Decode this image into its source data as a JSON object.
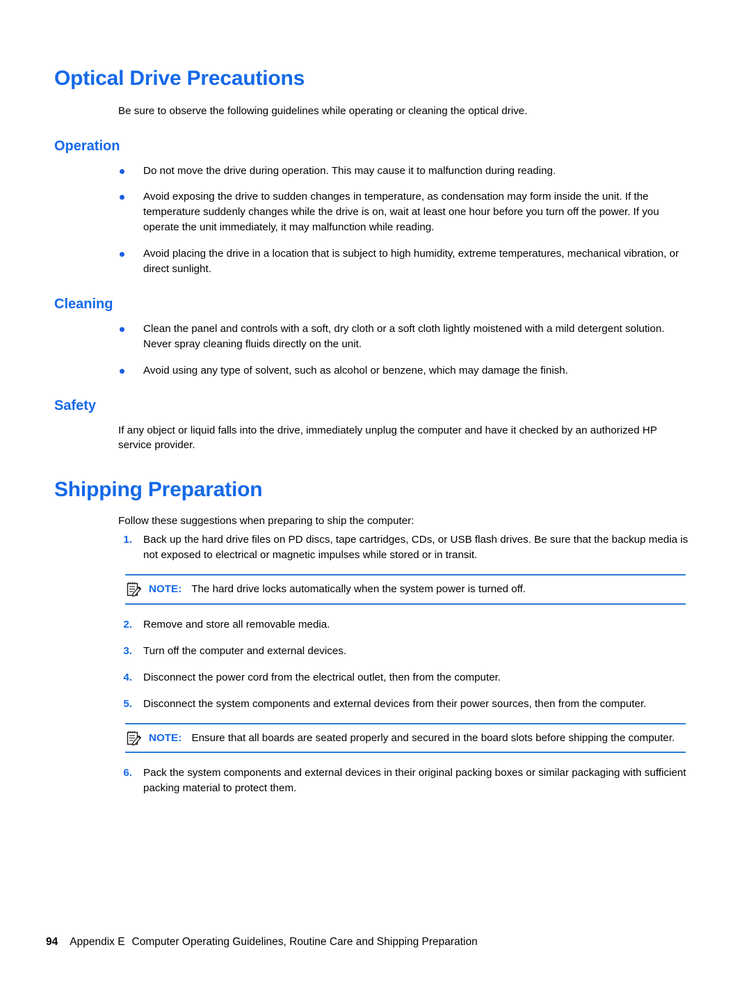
{
  "colors": {
    "heading_blue": "#1569e8",
    "bullet_blue": "#1a5fe0",
    "rule_blue": "#2b7bd4",
    "body_black": "#000000"
  },
  "sections": {
    "optical": {
      "title": "Optical Drive Precautions",
      "intro": "Be sure to observe the following guidelines while operating or cleaning the optical drive.",
      "operation": {
        "title": "Operation",
        "bullets": [
          "Do not move the drive during operation. This may cause it to malfunction during reading.",
          "Avoid exposing the drive to sudden changes in temperature, as condensation may form inside the unit. If the temperature suddenly changes while the drive is on, wait at least one hour before you turn off the power. If you operate the unit immediately, it may malfunction while reading.",
          "Avoid placing the drive in a location that is subject to high humidity, extreme temperatures, mechanical vibration, or direct sunlight."
        ]
      },
      "cleaning": {
        "title": "Cleaning",
        "bullets": [
          "Clean the panel and controls with a soft, dry cloth or a soft cloth lightly moistened with a mild detergent solution. Never spray cleaning fluids directly on the unit.",
          "Avoid using any type of solvent, such as alcohol or benzene, which may damage the finish."
        ]
      },
      "safety": {
        "title": "Safety",
        "paragraph": "If any object or liquid falls into the drive, immediately unplug the computer and have it checked by an authorized HP service provider."
      }
    },
    "shipping": {
      "title": "Shipping Preparation",
      "intro": "Follow these suggestions when preparing to ship the computer:",
      "steps": [
        {
          "num": "1.",
          "text": "Back up the hard drive files on PD discs, tape cartridges, CDs, or USB flash drives. Be sure that the backup media is not exposed to electrical or magnetic impulses while stored or in transit."
        },
        {
          "num": "2.",
          "text": "Remove and store all removable media."
        },
        {
          "num": "3.",
          "text": "Turn off the computer and external devices."
        },
        {
          "num": "4.",
          "text": "Disconnect the power cord from the electrical outlet, then from the computer."
        },
        {
          "num": "5.",
          "text": "Disconnect the system components and external devices from their power sources, then from the computer."
        },
        {
          "num": "6.",
          "text": "Pack the system components and external devices in their original packing boxes or similar packaging with sufficient packing material to protect them."
        }
      ],
      "note_one": {
        "label": "NOTE:",
        "text": "The hard drive locks automatically when the system power is turned off."
      },
      "note_two": {
        "label": "NOTE:",
        "text": "Ensure that all boards are seated properly and secured in the board slots before shipping the computer."
      }
    }
  },
  "footer": {
    "page_number": "94",
    "appendix": "Appendix E",
    "title": "Computer Operating Guidelines, Routine Care and Shipping Preparation"
  }
}
